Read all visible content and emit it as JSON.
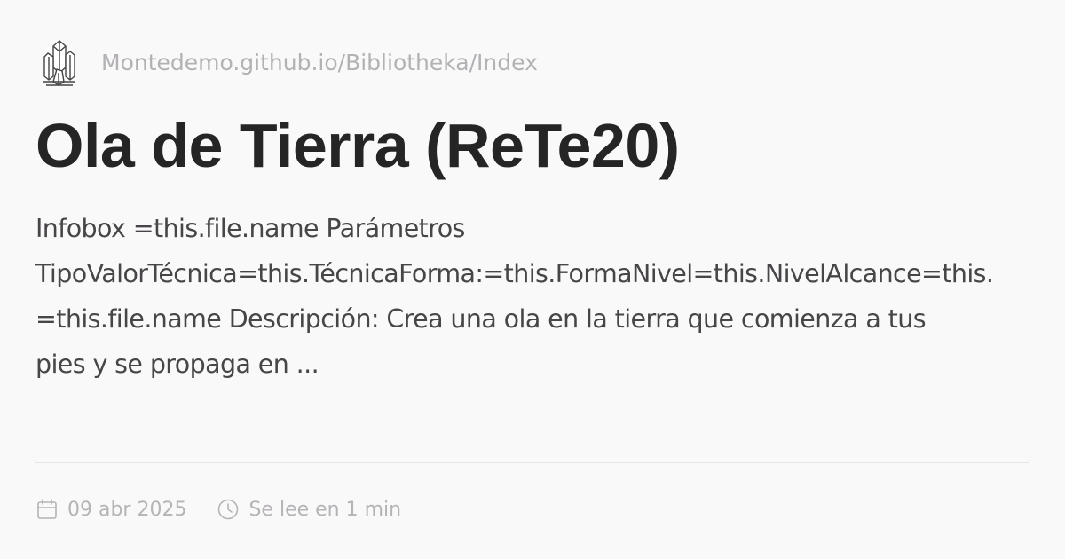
{
  "header": {
    "logo_icon": "crystal-cluster-icon",
    "site_path": "Montedemo.github.io/Bibliotheka/Index"
  },
  "article": {
    "title": "Ola de Tierra (ReTe20)",
    "excerpt_lines": [
      "Infobox =this.file.name Parámetros",
      "TipoValorTécnica=this.TécnicaForma:=this.FormaNivel=this.NivelAlcance=this.",
      "=this.file.name Descripción: Crea una ola en la tierra que comienza a tus",
      "pies y se propaga en ..."
    ]
  },
  "meta": {
    "date_icon": "calendar-icon",
    "date": "09 abr 2025",
    "reading_time_icon": "clock-icon",
    "reading_time": "Se lee en 1 min"
  },
  "colors": {
    "background": "#faf9fa",
    "title": "#262526",
    "body_text": "#474547",
    "muted_text": "#b3b1b4",
    "divider": "#e6e4e6"
  }
}
